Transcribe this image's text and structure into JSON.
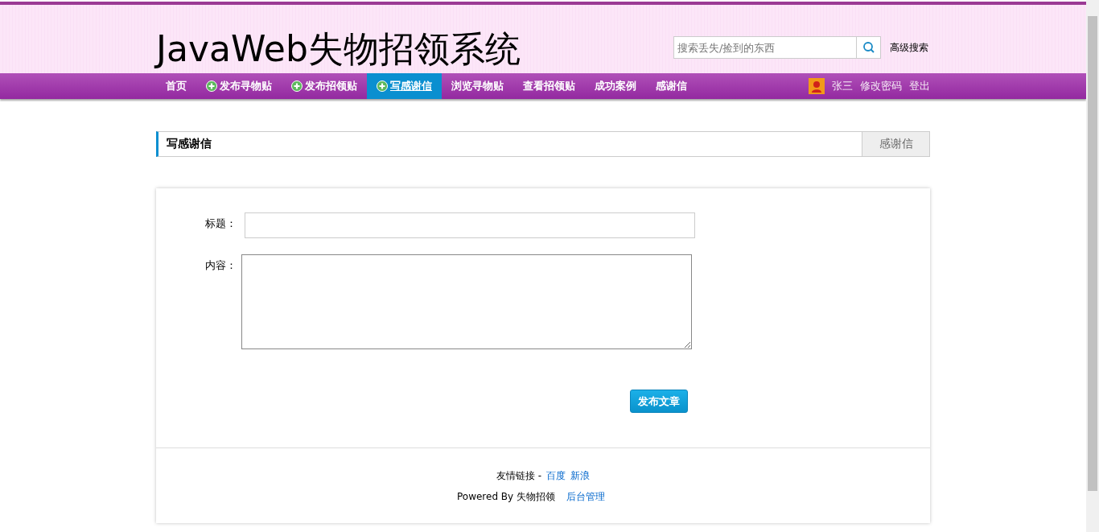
{
  "header": {
    "logo": "JavaWeb失物招领系统",
    "search": {
      "placeholder": "搜索丢失/捡到的东西"
    },
    "advanced_search": "高级搜索"
  },
  "nav": {
    "items": [
      {
        "label": "首页",
        "kind": "plain",
        "selected": false
      },
      {
        "label": "发布寻物贴",
        "kind": "add",
        "selected": false
      },
      {
        "label": "发布招领贴",
        "kind": "add",
        "selected": false
      },
      {
        "label": "写感谢信",
        "kind": "add",
        "selected": true
      },
      {
        "label": "浏览寻物贴",
        "kind": "plain",
        "selected": false
      },
      {
        "label": "查看招领贴",
        "kind": "plain",
        "selected": false
      },
      {
        "label": "成功案例",
        "kind": "plain",
        "selected": false
      },
      {
        "label": "感谢信",
        "kind": "plain",
        "selected": false
      }
    ],
    "user": "张三",
    "links": [
      "修改密码",
      "登出"
    ]
  },
  "section": {
    "title": "写感谢信",
    "tab": "感谢信"
  },
  "form": {
    "title_label": "标题：",
    "content_label": "内容：",
    "submit": "发布文章"
  },
  "footer": {
    "links_label": "友情链接 -",
    "links": [
      "百度",
      "新浪"
    ],
    "powered": "Powered By 失物招领",
    "admin": "后台管理"
  }
}
